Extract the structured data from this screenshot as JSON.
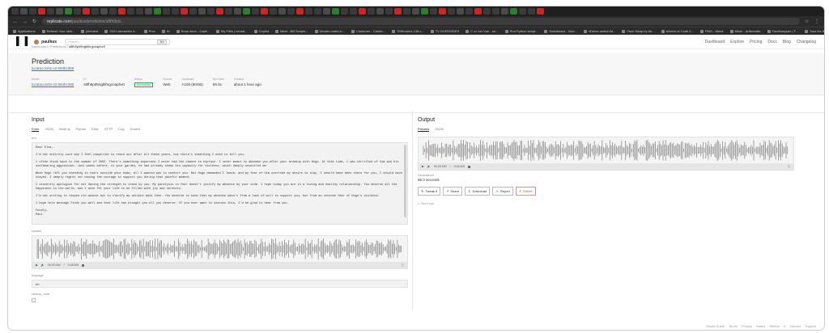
{
  "browser": {
    "url_host": "replicate.com",
    "url_path": "/paulkus/prediction/s8fh9pd..."
  },
  "bookmarks": [
    "Applications",
    "Refresh Your skin...",
    "jimforest",
    "2021 alexandre d...",
    "Prec",
    "AI",
    "Nous deux - Capit...",
    "My Files | neural...",
    "Copilot",
    "Meet - Bill Scripts...",
    "Ubuntu notes in...",
    "Customer - Cardio...",
    "TMSmarez 138 c...",
    "TV OVERSIDES",
    "C cc ner Vue - un...",
    "Run Python script...",
    "Dashboard - Vuel...",
    "nDemo webuiVid...",
    "Face Swap by Ak...",
    "Advent of Code 2...",
    "PMO - Week",
    "Mixer - Artbreeder",
    "Facebunpper | F...",
    "Tous les favoris"
  ],
  "nav": {
    "logo": "▌▐",
    "username": "paulkus",
    "search_placeholder": "Search...",
    "search_shortcut": "⌘K",
    "links": [
      "Dashboard",
      "Explore",
      "Pricing",
      "Docs",
      "Blog",
      "Changelog"
    ]
  },
  "breadcrumb": {
    "a": "Dashboard",
    "b": "Predictions",
    "c": "s8fh9pd9ngblhrgcnaphv0"
  },
  "prediction": {
    "title": "Prediction",
    "model_link": "lucataco/xtts-v2:684bc385",
    "meta": {
      "model_label": "Model",
      "model_value": "lucataco/xtts-v2:684bc385",
      "id_label": "ID",
      "id_value": "s8fh9pd9ngblhrgcnaphv0",
      "status_label": "Status",
      "status_value": "Succeeded",
      "source_label": "Source",
      "source_value": "Web",
      "hardware_label": "Hardware",
      "hardware_value": "A100 (80GB)",
      "runtime_label": "Run time",
      "runtime_value": "69.3s",
      "created_label": "Created",
      "created_value": "about 1 hour ago"
    }
  },
  "input": {
    "title": "Input",
    "tabs": [
      "Form",
      "JSON",
      "Node.js",
      "Python",
      "Elixir",
      "HTTP",
      "Cog",
      "Docker"
    ],
    "text_label": "text",
    "text_paragraphs": [
      "Dear Elsa,",
      "I'm not entirely sure why I feel compelled to reach out after all these years, but there's something I need to tell you.",
      "I often think back to the summer of 2002. There's something important I never had the chance to explain. I never meant to abandon you after your breakup with Hugo. At that time, I was terrified of him and his overbearing aggression. Just weeks before, in your garden, he had already shown his capacity for violence, which deeply unsettled me.",
      "When Hugo left you standing in tears outside your home, all I wanted was to comfort you. But Hugo demanded I leave, and my fear of him overrode my desire to stay. I should have been there for you, I should have stayed. I deeply regret not having the courage to support you during that painful moment.",
      "I sincerely apologize for not having the strength to stand by you. My paralysis in fear doesn't justify my absence by your side. I hope today you are in a loving and healthy relationship. You deserve all the happiness in the world, and I wish for your life to be filled with joy and serenity.",
      "I'm not writing to reopen old wounds but to clarify my actions back then. You deserve to know that my absence wasn't from a lack of will to support you, but from an intense fear of Hugo's violence.",
      "I hope this message finds you well and that life has brought you all you deserve. If you ever want to discuss this, I'd be glad to hear from you.",
      "Fondly,\nPaul"
    ],
    "speaker_label": "speaker",
    "speaker_time": "00:00.000",
    "speaker_total": "0:18.000",
    "language_label": "language",
    "language_value": "en",
    "cleanup_label": "cleanup_voice"
  },
  "output": {
    "title": "Output",
    "tabs": [
      "Preview",
      "JSON"
    ],
    "time": "00:00.000",
    "total": "0:18.400",
    "generated_label": "Generated in",
    "generated_value": "68.3 seconds",
    "buttons": [
      "Tweak it",
      "Share",
      "Download",
      "Report",
      "Delete"
    ],
    "show_logs": "Show logs"
  },
  "footer": [
    "Model Guide",
    "Terms",
    "Privacy",
    "Status",
    "GitHub",
    "X",
    "Discord",
    "Support"
  ],
  "colors": {
    "accent": "#4a6fa5",
    "success": "#2e9d4e",
    "danger": "#d34a4a"
  }
}
